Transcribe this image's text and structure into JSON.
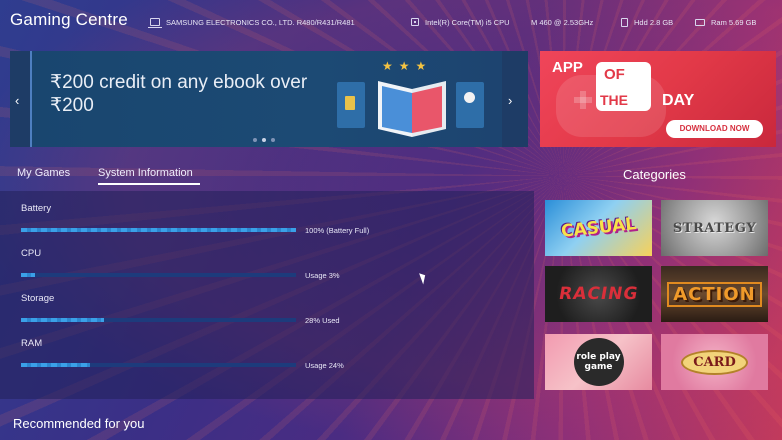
{
  "header": {
    "title": "Gaming Centre",
    "device": "SAMSUNG ELECTRONICS CO., LTD. R480/R431/R481",
    "cpu": "Intel(R) Core(TM) i5 CPU",
    "cpu_speed": "M 460  @ 2.53GHz",
    "hdd": "Hdd 2.8 GB",
    "ram": "Ram 5.69 GB"
  },
  "banner": {
    "text": "₹200 credit on any ebook over ₹200",
    "prev_icon": "‹",
    "next_icon": "›"
  },
  "app_of_the_day": {
    "app": "APP",
    "of": "OF",
    "the": "THE",
    "day": "DAY",
    "button_label": "DOWNLOAD NOW"
  },
  "tabs": {
    "my_games": "My Games",
    "system_information": "System Information",
    "active": "System Information"
  },
  "categories_title": "Categories",
  "system_info": {
    "battery": {
      "label": "Battery",
      "value": "100%  (Battery Full)",
      "fraction": 1.0
    },
    "cpu": {
      "label": "CPU",
      "value": "Usage 3%",
      "fraction": 0.05
    },
    "storage": {
      "label": "Storage",
      "value": "28% Used",
      "fraction": 0.3
    },
    "ram": {
      "label": "RAM",
      "value": "Usage 24%",
      "fraction": 0.25
    }
  },
  "categories": {
    "casual": "CASUAL",
    "strategy": "STRATEGY",
    "racing": "RACING",
    "action": "ACTION",
    "roleplay": "role play game",
    "card": "CARD"
  },
  "recommended": "Recommended for you",
  "colors": {
    "accent": "#3aa0e8",
    "aotd_red": "#e23948",
    "banner_bg": "#18476e"
  }
}
